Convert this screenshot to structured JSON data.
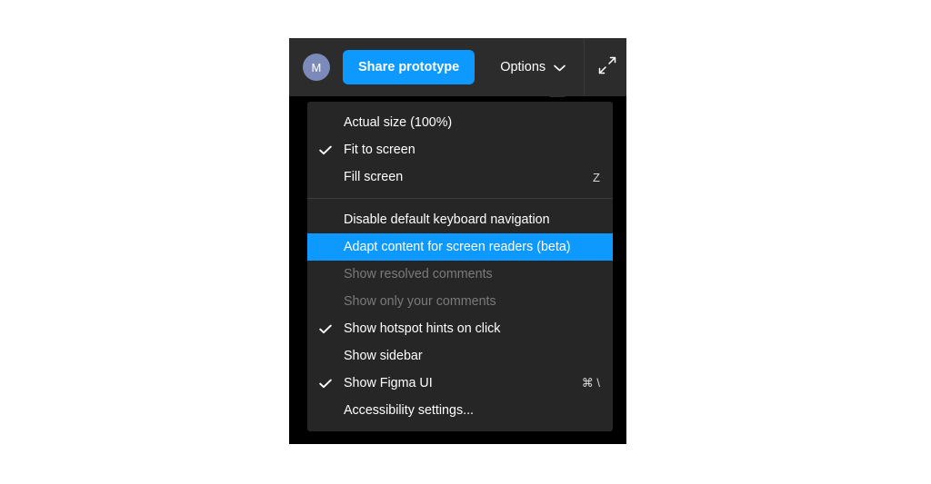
{
  "toolbar": {
    "avatar_initial": "M",
    "avatar_name": "avatar",
    "share_label": "Share prototype",
    "options_label": "Options",
    "chevron_icon": "chevron-down-icon",
    "expand_icon": "expand-fullscreen-icon",
    "accent_color": "#0d99ff",
    "background_color": "#2c2c2c",
    "avatar_color": "#7b8ab8"
  },
  "menu": {
    "background_color": "#262626",
    "highlight_color": "#0d99ff",
    "check_glyph": "✓",
    "groups": [
      {
        "items": [
          {
            "label": "Actual size (100%)",
            "checked": false,
            "shortcut": "",
            "disabled": false,
            "selected": false
          },
          {
            "label": "Fit to screen",
            "checked": true,
            "shortcut": "",
            "disabled": false,
            "selected": false
          },
          {
            "label": "Fill screen",
            "checked": false,
            "shortcut": "Z",
            "disabled": false,
            "selected": false
          }
        ]
      },
      {
        "items": [
          {
            "label": "Disable default keyboard navigation",
            "checked": false,
            "shortcut": "",
            "disabled": false,
            "selected": false
          },
          {
            "label": "Adapt content for screen readers (beta)",
            "checked": false,
            "shortcut": "",
            "disabled": false,
            "selected": true
          },
          {
            "label": "Show resolved comments",
            "checked": false,
            "shortcut": "",
            "disabled": true,
            "selected": false
          },
          {
            "label": "Show only your comments",
            "checked": false,
            "shortcut": "",
            "disabled": true,
            "selected": false
          },
          {
            "label": "Show hotspot hints on click",
            "checked": true,
            "shortcut": "",
            "disabled": false,
            "selected": false
          },
          {
            "label": "Show sidebar",
            "checked": false,
            "shortcut": "",
            "disabled": false,
            "selected": false
          },
          {
            "label": "Show Figma UI",
            "checked": true,
            "shortcut": "⌘ \\",
            "disabled": false,
            "selected": false
          },
          {
            "label": "Accessibility settings...",
            "checked": false,
            "shortcut": "",
            "disabled": false,
            "selected": false
          }
        ]
      }
    ]
  }
}
